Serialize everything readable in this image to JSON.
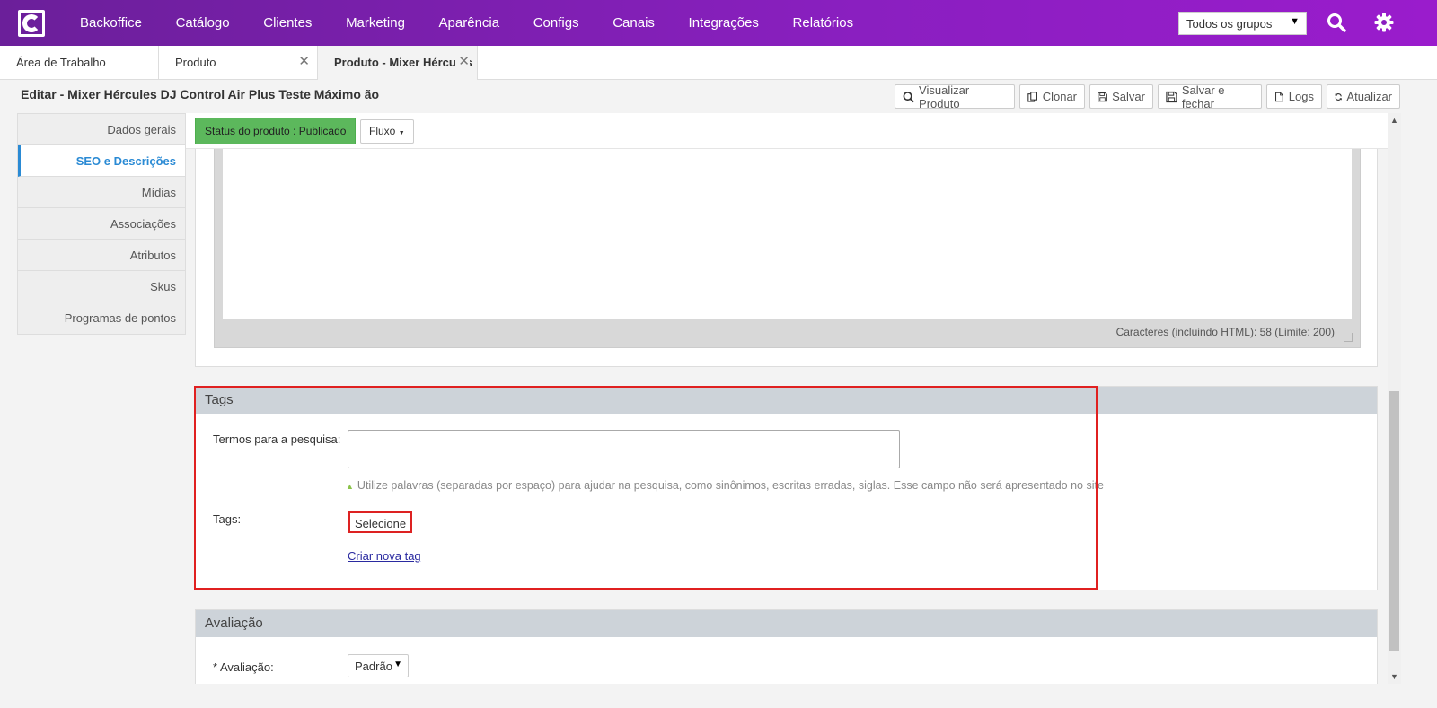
{
  "nav": {
    "items": [
      "Backoffice",
      "Catálogo",
      "Clientes",
      "Marketing",
      "Aparência",
      "Configs",
      "Canais",
      "Integrações",
      "Relatórios"
    ],
    "group_select": "Todos os grupos"
  },
  "tabs": [
    {
      "label": "Área de Trabalho"
    },
    {
      "label": "Produto"
    },
    {
      "label": "Produto - Mixer Hércules"
    }
  ],
  "page": {
    "title": "Editar - Mixer Hércules DJ Control Air Plus Teste Máximo ão"
  },
  "toolbar": {
    "view_product": "Visualizar Produto",
    "clone": "Clonar",
    "save": "Salvar",
    "save_close": "Salvar e fechar",
    "logs": "Logs",
    "refresh": "Atualizar"
  },
  "sidebar": {
    "items": [
      {
        "label": "Dados gerais"
      },
      {
        "label": "SEO e Descrições"
      },
      {
        "label": "Mídias"
      },
      {
        "label": "Associações"
      },
      {
        "label": "Atributos"
      },
      {
        "label": "Skus"
      },
      {
        "label": "Programas de pontos"
      }
    ]
  },
  "status": {
    "label": "Status do produto : Publicado",
    "flow": "Fluxo"
  },
  "editor": {
    "char_count": "Caracteres (incluindo HTML): 58 (Limite: 200)"
  },
  "tags_section": {
    "title": "Tags",
    "search_terms_label": "Termos para a pesquisa:",
    "search_terms_value": "",
    "hint": "Utilize palavras (separadas por espaço) para ajudar na pesquisa, como sinônimos, escritas erradas, siglas. Esse campo não será apresentado no site",
    "tags_label": "Tags:",
    "select_label": "Selecione",
    "new_tag_link": "Criar nova tag"
  },
  "rating_section": {
    "title": "Avaliação",
    "label": "* Avaliação:",
    "value": "Padrão"
  }
}
